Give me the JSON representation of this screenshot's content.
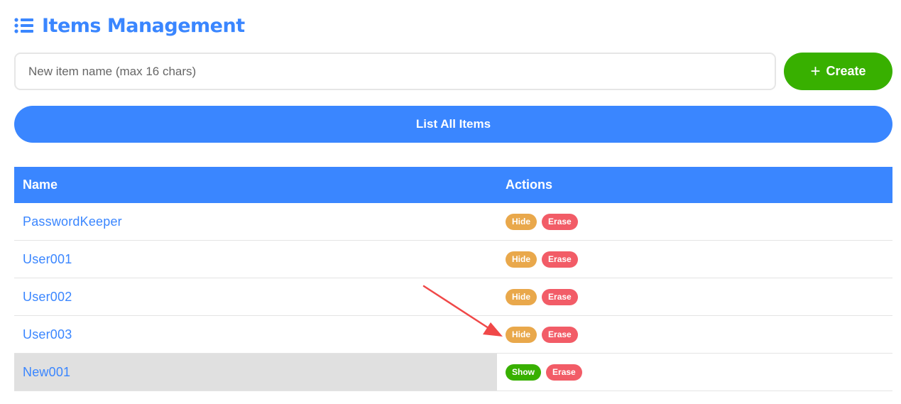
{
  "header": {
    "title": "Items Management",
    "icon": "list-icon",
    "accent_color": "#3a86ff"
  },
  "create_form": {
    "input_value": "",
    "input_placeholder": "New item name (max 16 chars)",
    "create_label": "Create",
    "create_icon": "plus-icon",
    "create_color": "#38b000"
  },
  "list_all": {
    "label": "List All Items"
  },
  "table": {
    "headers": {
      "name": "Name",
      "actions": "Actions"
    },
    "rows": [
      {
        "name": "PasswordKeeper",
        "visibility_action": "Hide",
        "erase_action": "Erase",
        "hidden": false
      },
      {
        "name": "User001",
        "visibility_action": "Hide",
        "erase_action": "Erase",
        "hidden": false
      },
      {
        "name": "User002",
        "visibility_action": "Hide",
        "erase_action": "Erase",
        "hidden": false
      },
      {
        "name": "User003",
        "visibility_action": "Hide",
        "erase_action": "Erase",
        "hidden": false
      },
      {
        "name": "New001",
        "visibility_action": "Show",
        "erase_action": "Erase",
        "hidden": true
      }
    ]
  },
  "annotation": {
    "type": "arrow",
    "color": "#f04848",
    "target": "row 4 Hide button"
  }
}
